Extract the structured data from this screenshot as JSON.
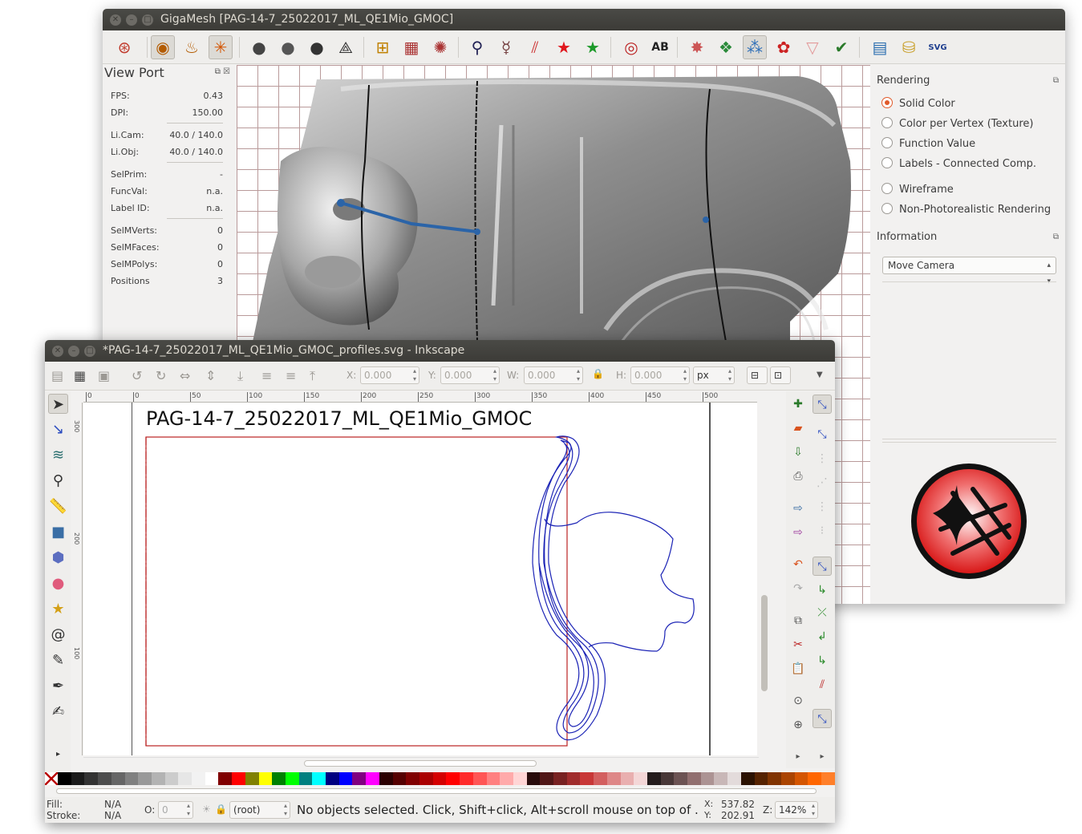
{
  "gigamesh": {
    "title": "GigaMesh [PAG-14-7_25022017_ML_QE1Mio_GMOC]",
    "toolbar_icons": [
      "camera-target-icon",
      "eye-1-icon",
      "light-2-icon",
      "light-a-icon",
      "sphere-m-icon",
      "sphere-d-icon",
      "sphere-s-icon",
      "pyramid-icon",
      "grid-cross-icon",
      "grid-icon",
      "polar-grid-icon",
      "search-plus-icon",
      "figure-icon",
      "strikethrough-icon",
      "red-star-icon",
      "green-star-icon",
      "target-icon",
      "ab-icon",
      "burst-icon",
      "green-cube-icon",
      "blue-circles-icon",
      "red-green-badge-icon",
      "cup-icon",
      "checkmark-icon",
      "palette-icon",
      "cylinder-icon",
      "svg-export-icon"
    ],
    "toolbar_svg_label": "SVG",
    "viewport": {
      "title": "View Port",
      "rows": [
        {
          "label": "FPS:",
          "value": "0.43"
        },
        {
          "label": "DPI:",
          "value": "150.00"
        },
        {
          "label": "Li.Cam:",
          "value": "40.0 / 140.0"
        },
        {
          "label": "Li.Obj:",
          "value": "40.0 / 140.0"
        },
        {
          "label": "SelPrim:",
          "value": "-"
        },
        {
          "label": "FuncVal:",
          "value": "n.a."
        },
        {
          "label": "Label ID:",
          "value": "n.a."
        },
        {
          "label": "SelMVerts:",
          "value": "0"
        },
        {
          "label": "SelMFaces:",
          "value": "0"
        },
        {
          "label": "SelMPolys:",
          "value": "0"
        },
        {
          "label": "Positions",
          "value": "3"
        }
      ]
    },
    "rendering": {
      "title": "Rendering",
      "options": [
        {
          "label": "Solid Color",
          "selected": true
        },
        {
          "label": "Color per Vertex (Texture)",
          "selected": false
        },
        {
          "label": "Function Value",
          "selected": false
        },
        {
          "label": "Labels - Connected Comp.",
          "selected": false
        },
        {
          "label": "Wireframe",
          "selected": false
        },
        {
          "label": "Non-Photorealistic Rendering",
          "selected": false
        }
      ]
    },
    "information": {
      "title": "Information",
      "mode": "Move Camera"
    }
  },
  "inkscape": {
    "title": "*PAG-14-7_25022017_ML_QE1Mio_GMOC_profiles.svg - Inkscape",
    "toolbar": {
      "x_label": "X:",
      "x_value": "0.000",
      "y_label": "Y:",
      "y_value": "0.000",
      "w_label": "W:",
      "w_value": "0.000",
      "h_label": "H:",
      "h_value": "0.000",
      "unit": "px"
    },
    "hruler_ticks": [
      "0",
      "0",
      "50",
      "100",
      "150",
      "200",
      "250",
      "300",
      "350",
      "400",
      "450",
      "500"
    ],
    "vruler_ticks": [
      "300",
      "200",
      "100"
    ],
    "canvas_heading": "PAG-14-7_25022017_ML_QE1Mio_GMOC",
    "palette": [
      "#000000",
      "#1a1a1a",
      "#333333",
      "#4d4d4d",
      "#666666",
      "#808080",
      "#999999",
      "#b3b3b3",
      "#cccccc",
      "#e6e6e6",
      "#f2f2f2",
      "#ffffff",
      "#800000",
      "#ff0000",
      "#808000",
      "#ffff00",
      "#008000",
      "#00ff00",
      "#008080",
      "#00ffff",
      "#000080",
      "#0000ff",
      "#800080",
      "#ff00ff",
      "#2b0000",
      "#550000",
      "#800000",
      "#aa0000",
      "#d40000",
      "#ff0000",
      "#ff2a2a",
      "#ff5555",
      "#ff8080",
      "#ffaaaa",
      "#ffd5d5",
      "#280b0b",
      "#501616",
      "#782121",
      "#a02c2c",
      "#c83737",
      "#d35f5f",
      "#de8787",
      "#e9afaf",
      "#f4d7d7",
      "#241c1c",
      "#483737",
      "#6c5353",
      "#916f6f",
      "#ac9393",
      "#c8b7b7",
      "#e3dbdb",
      "#2b1100",
      "#552200",
      "#803300",
      "#aa4400",
      "#d45500",
      "#ff6600",
      "#ff7f2a"
    ],
    "status": {
      "fill_label": "Fill:",
      "fill_value": "N/A",
      "stroke_label": "Stroke:",
      "stroke_value": "N/A",
      "opacity_label": "O:",
      "opacity_value": "0",
      "layer": "(root)",
      "message": "No objects selected. Click, Shift+click, Alt+scroll mouse on top of .",
      "x_label": "X:",
      "x_value": "537.82",
      "y_label": "Y:",
      "y_value": "202.91",
      "zoom_label": "Z:",
      "zoom_value": "142%"
    }
  }
}
